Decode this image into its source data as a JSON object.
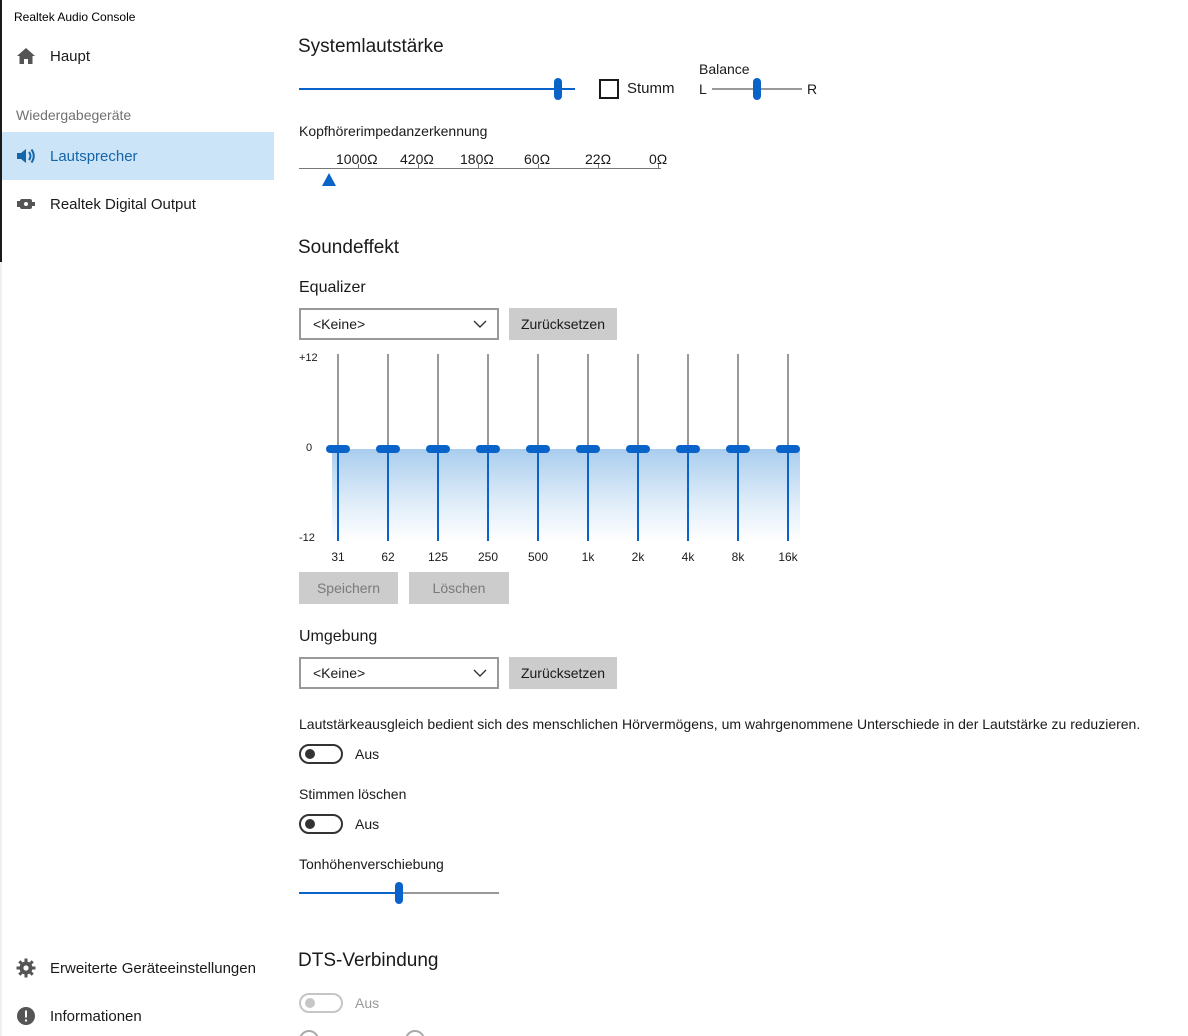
{
  "app": {
    "title": "Realtek Audio Console"
  },
  "sidebar": {
    "home_label": "Haupt",
    "section_label": "Wiedergabegeräte",
    "devices": [
      {
        "label": "Lautsprecher",
        "active": true
      },
      {
        "label": "Realtek Digital Output",
        "active": false
      }
    ],
    "advanced_label": "Erweiterte Geräteeinstellungen",
    "info_label": "Informationen"
  },
  "system_volume": {
    "heading": "Systemlautstärke",
    "level": 0.93,
    "mute_label": "Stumm",
    "mute_checked": false,
    "balance_label": "Balance",
    "balance_left": "L",
    "balance_right": "R",
    "balance_level": 0.5
  },
  "headphone_impedance": {
    "label": "Kopfhörerimpedanzerkennung",
    "ticks": [
      "1000Ω",
      "420Ω",
      "180Ω",
      "60Ω",
      "22Ω",
      "0Ω"
    ]
  },
  "sound_effect": {
    "heading": "Soundeffekt",
    "equalizer_label": "Equalizer",
    "equalizer_value": "<Keine>",
    "reset_label": "Zurücksetzen",
    "scale_max": "+12",
    "scale_mid": "0",
    "scale_min": "-12",
    "bands": [
      {
        "freq": "31",
        "gain": 0
      },
      {
        "freq": "62",
        "gain": 0
      },
      {
        "freq": "125",
        "gain": 0
      },
      {
        "freq": "250",
        "gain": 0
      },
      {
        "freq": "500",
        "gain": 0
      },
      {
        "freq": "1k",
        "gain": 0
      },
      {
        "freq": "2k",
        "gain": 0
      },
      {
        "freq": "4k",
        "gain": 0
      },
      {
        "freq": "8k",
        "gain": 0
      },
      {
        "freq": "16k",
        "gain": 0
      }
    ],
    "save_label": "Speichern",
    "delete_label": "Löschen",
    "environment_label": "Umgebung",
    "environment_value": "<Keine>",
    "environment_reset_label": "Zurücksetzen",
    "loudness_text": "Lautstärkeausgleich bedient sich des menschlichen Hörvermögens, um wahrgenommene Unterschiede in der Lautstärke zu reduzieren.",
    "loudness_state": "Aus",
    "voice_cancel_label": "Stimmen löschen",
    "voice_cancel_state": "Aus",
    "pitch_label": "Tonhöhenverschiebung",
    "pitch_level": 0.5
  },
  "dts": {
    "heading": "DTS-Verbindung",
    "state": "Aus"
  }
}
